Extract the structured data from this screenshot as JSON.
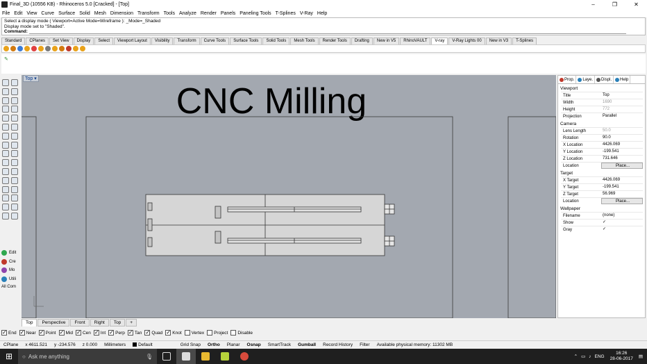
{
  "window": {
    "title": "Final_3D (10556 KB) - Rhinoceros 5.0 [Cracked] - [Top]",
    "minimize": "–",
    "maximize": "❐",
    "close": "✕"
  },
  "menu": [
    "File",
    "Edit",
    "View",
    "Curve",
    "Surface",
    "Solid",
    "Mesh",
    "Dimension",
    "Transform",
    "Tools",
    "Analyze",
    "Render",
    "Panels",
    "Paneling Tools",
    "T-Splines",
    "V-Ray",
    "Help"
  ],
  "command": {
    "history1": "Select a display mode ( Viewport=Active  Mode=Wireframe ):  _Mode=_Shaded",
    "history2": "Display mode set to \"Shaded\".",
    "prompt": "Command:"
  },
  "toolbar_tabs": [
    "Standard",
    "CPlanes",
    "Set View",
    "Display",
    "Select",
    "Viewport Layout",
    "Visibility",
    "Transform",
    "Curve Tools",
    "Surface Tools",
    "Solid Tools",
    "Mesh Tools",
    "Render Tools",
    "Drafting",
    "New in V5",
    "RhinoVAULT",
    "V-ray",
    "V-Ray Lights 00",
    "New in V3",
    "T-Splines"
  ],
  "active_toolbar_tab": "V-ray",
  "viewport": {
    "label": "Top ▾",
    "title_text": "CNC Milling"
  },
  "left_labels": [
    "Edit",
    "Cre",
    "Mo",
    "Utili",
    "All Com"
  ],
  "view_tabs": [
    "Top",
    "Perspective",
    "Front",
    "Right",
    "Top",
    "+"
  ],
  "osnaps": [
    {
      "label": "End",
      "on": true
    },
    {
      "label": "Near",
      "on": true
    },
    {
      "label": "Point",
      "on": true
    },
    {
      "label": "Mid",
      "on": true
    },
    {
      "label": "Cen",
      "on": true
    },
    {
      "label": "Int",
      "on": true
    },
    {
      "label": "Perp",
      "on": true
    },
    {
      "label": "Tan",
      "on": true
    },
    {
      "label": "Quad",
      "on": true
    },
    {
      "label": "Knot",
      "on": true
    },
    {
      "label": "Vertex",
      "on": false
    },
    {
      "label": "Project",
      "on": false
    },
    {
      "label": "Disable",
      "on": false
    }
  ],
  "status": {
    "cplane": "CPlane",
    "x": "x 4611.521",
    "y": "y -234.576",
    "z": "z 0.000",
    "units": "Millimeters",
    "layer": "Default",
    "grid_snap": "Grid Snap",
    "ortho": "Ortho",
    "planar": "Planar",
    "osnap": "Osnap",
    "smarttrack": "SmartTrack",
    "gumball": "Gumball",
    "record": "Record History",
    "filter": "Filter",
    "memory": "Available physical memory: 11302 MB"
  },
  "properties": {
    "tabs": [
      "Prop.",
      "Laye.",
      "Displ.",
      "Help"
    ],
    "viewport_header": "Viewport",
    "viewport_rows": [
      {
        "label": "Title",
        "value": "Top"
      },
      {
        "label": "Width",
        "value": "1690",
        "grey": true
      },
      {
        "label": "Height",
        "value": "772",
        "grey": true
      },
      {
        "label": "Projection",
        "value": "Parallel"
      }
    ],
    "camera_header": "Camera",
    "camera_rows": [
      {
        "label": "Lens Length",
        "value": "50.0",
        "grey": true
      },
      {
        "label": "Rotation",
        "value": "90.0"
      },
      {
        "label": "X Location",
        "value": "4426.069"
      },
      {
        "label": "Y Location",
        "value": "-199.541"
      },
      {
        "label": "Z Location",
        "value": "731.646"
      },
      {
        "label": "Location",
        "value": "Place...",
        "button": true
      }
    ],
    "target_header": "Target",
    "target_rows": [
      {
        "label": "X Target",
        "value": "4426.069"
      },
      {
        "label": "Y Target",
        "value": "-199.541"
      },
      {
        "label": "Z Target",
        "value": "56.969"
      },
      {
        "label": "Location",
        "value": "Place...",
        "button": true
      }
    ],
    "wallpaper_header": "Wallpaper",
    "wallpaper_rows": [
      {
        "label": "Filename",
        "value": "(none)"
      },
      {
        "label": "Show",
        "value": "✓"
      },
      {
        "label": "Gray",
        "value": "✓"
      }
    ]
  },
  "taskbar": {
    "search": "Ask me anything",
    "language": "ENG",
    "time": "16:26",
    "date": "28-06-2017"
  }
}
